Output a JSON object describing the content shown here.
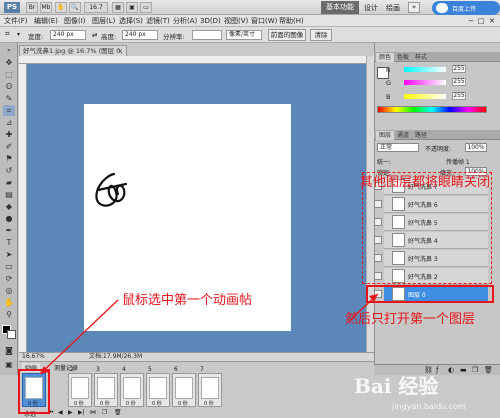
{
  "titlebar": {
    "logo": "PS",
    "zoom": "16.7",
    "workspaces": [
      "基本功能",
      "设计",
      "绘画"
    ],
    "search_icon": "double-chevron-icon",
    "badge": "百度上传"
  },
  "menubar": {
    "items": [
      "文件(F)",
      "编辑(E)",
      "图像(I)",
      "图层(L)",
      "选择(S)",
      "滤镜(T)",
      "分析(A)",
      "3D(D)",
      "视图(V)",
      "窗口(W)",
      "帮助(H)"
    ]
  },
  "options": {
    "width_label": "宽度:",
    "width_value": "240 px",
    "height_value": "240 px",
    "resolution_label": "分辨率:",
    "unit_value": "像素/英寸",
    "front_image_button": "前面的图像",
    "clear_button": "清除"
  },
  "document": {
    "tab_title": "好气洗鼻1.jpg @ 16.7% (图层 0, RGB/8#)",
    "status_zoom": "16.67%",
    "status_doc": "文档:17.9M/26.3M"
  },
  "color_panel": {
    "tabs": [
      "颜色",
      "色板",
      "样式"
    ],
    "channels": [
      {
        "label": "R",
        "value": "255"
      },
      {
        "label": "G",
        "value": "255"
      },
      {
        "label": "B",
        "value": "255"
      }
    ]
  },
  "layers_panel": {
    "tabs": [
      "图层",
      "通道",
      "路径"
    ],
    "blend_mode": "正常",
    "opacity_label": "不透明度:",
    "opacity_value": "100%",
    "unify_label": "统一:",
    "propagate_label": "传播帧 1",
    "lock_label": "锁定:",
    "fill_label": "填充:",
    "fill_value": "100%",
    "layers": [
      {
        "name": "好气洗鼻 7",
        "selected": false
      },
      {
        "name": "好气洗鼻 6",
        "selected": false
      },
      {
        "name": "好气洗鼻 5",
        "selected": false
      },
      {
        "name": "好气洗鼻 4",
        "selected": false
      },
      {
        "name": "好气洗鼻 3",
        "selected": false
      },
      {
        "name": "好气洗鼻 2",
        "selected": false
      },
      {
        "name": "图层 0",
        "selected": true
      }
    ]
  },
  "animation_panel": {
    "tabs": [
      "动画",
      "测量记录"
    ],
    "frames": [
      {
        "num": "1",
        "duration": "0 秒",
        "selected": true
      },
      {
        "num": "2",
        "duration": "0 秒",
        "selected": false
      },
      {
        "num": "3",
        "duration": "0 秒",
        "selected": false
      },
      {
        "num": "4",
        "duration": "0 秒",
        "selected": false
      },
      {
        "num": "5",
        "duration": "0 秒",
        "selected": false
      },
      {
        "num": "6",
        "duration": "0 秒",
        "selected": false
      },
      {
        "num": "7",
        "duration": "0 秒",
        "selected": false
      }
    ],
    "loop_label": "永远"
  },
  "annotations": {
    "select_frame": "鼠标选中第一个动画帖",
    "hide_layers": "其他图层都将眼睛关闭",
    "open_first_layer": "然后只打开第一个图层"
  },
  "watermark": {
    "text": "Bai 经验",
    "url": "jingyan.baidu.com"
  },
  "colors": {
    "canvas_bg": "#5b88b9",
    "selection_blue": "#3d8ee3",
    "annotation_red": "#e8161b"
  }
}
